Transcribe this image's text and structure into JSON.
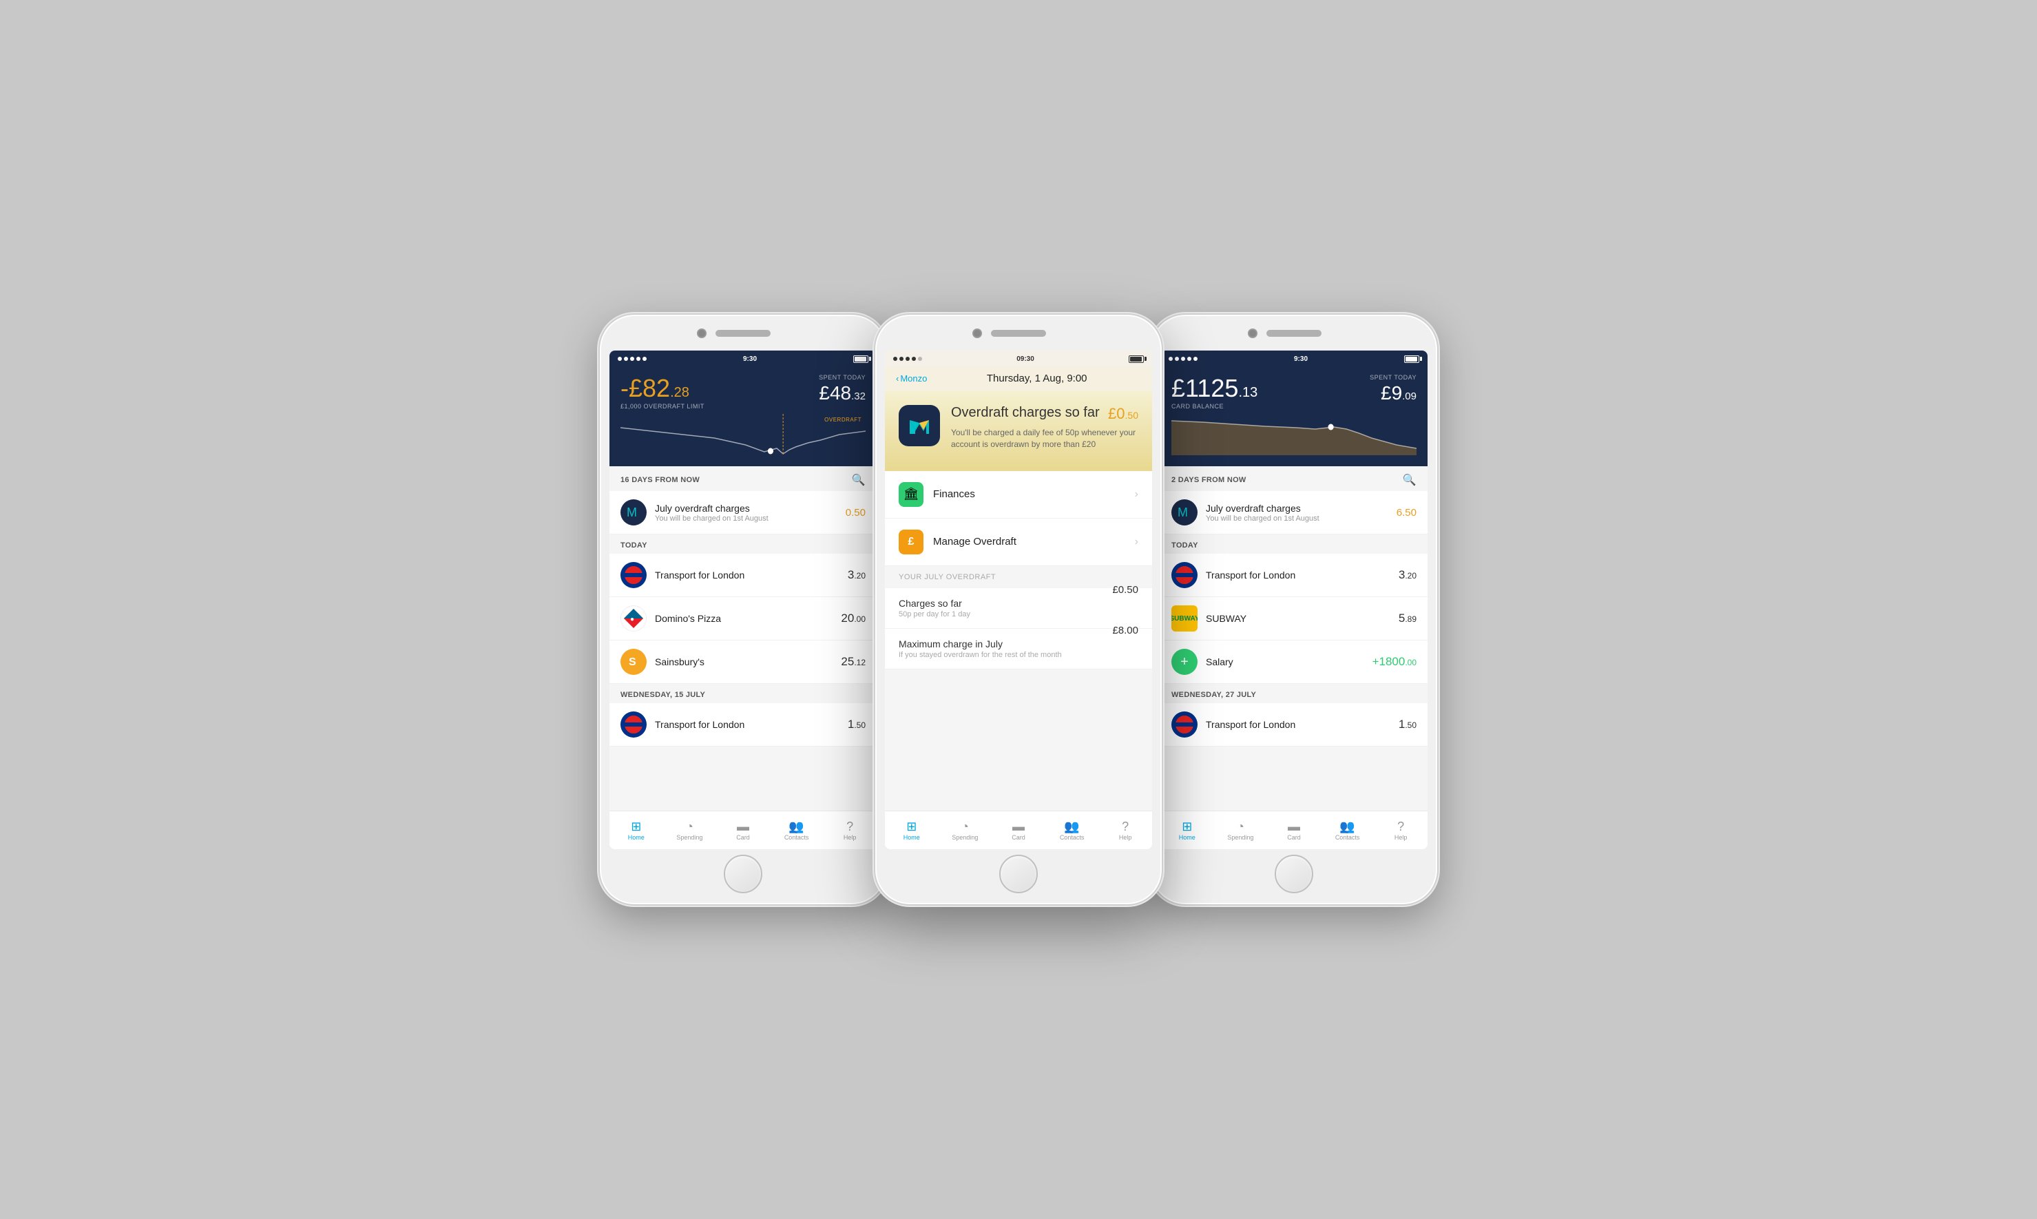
{
  "phone1": {
    "status": {
      "time": "9:30",
      "signal_dots": 5
    },
    "header": {
      "balance_sign": "-",
      "balance_currency": "£",
      "balance_whole": "82",
      "balance_decimal": ".28",
      "balance_label": "£1,000 OVERDRAFT LIMIT",
      "spent_currency": "£",
      "spent_whole": "48",
      "spent_decimal": ".32",
      "spent_label": "SPENT TODAY",
      "overdraft_label": "OVERDRAFT"
    },
    "section1": {
      "label": "16 DAYS FROM NOW"
    },
    "overdraft_item": {
      "name": "July overdraft charges",
      "sub": "You will be charged on 1st August",
      "amount_whole": "0",
      "amount_decimal": ".50"
    },
    "today_section": {
      "label": "TODAY"
    },
    "transactions": [
      {
        "name": "Transport for London",
        "sub": "",
        "amount_whole": "3",
        "amount_decimal": ".20",
        "type": "tfl"
      },
      {
        "name": "Domino's Pizza",
        "sub": "",
        "amount_whole": "20",
        "amount_decimal": ".00",
        "type": "dominos"
      },
      {
        "name": "Sainsbury's",
        "sub": "",
        "amount_whole": "25",
        "amount_decimal": ".12",
        "type": "sainsburys"
      }
    ],
    "section2": {
      "label": "WEDNESDAY, 15 JULY"
    },
    "transactions2": [
      {
        "name": "Transport for London",
        "sub": "",
        "amount_whole": "1",
        "amount_decimal": ".50",
        "type": "tfl"
      }
    ],
    "nav": {
      "items": [
        {
          "label": "Home",
          "active": true
        },
        {
          "label": "Spending",
          "active": false
        },
        {
          "label": "Card",
          "active": false
        },
        {
          "label": "Contacts",
          "active": false
        },
        {
          "label": "Help",
          "active": false
        }
      ]
    }
  },
  "phone2": {
    "status": {
      "time": "09:30"
    },
    "header": {
      "back_label": "Monzo",
      "date": "Thursday, 1 Aug, 9:00"
    },
    "overdraft": {
      "title": "Overdraft charges so far",
      "amount": "£0",
      "amount_decimal": ".50",
      "description": "You'll be charged a daily fee of 50p whenever your account is overdrawn by more than £20"
    },
    "menu_items": [
      {
        "label": "Finances",
        "icon_type": "bank"
      },
      {
        "label": "Manage Overdraft",
        "icon_type": "pound"
      }
    ],
    "section_label": "YOUR JULY OVERDRAFT",
    "detail_rows": [
      {
        "title": "Charges so far",
        "sub": "50p per day for 1 day",
        "amount": "£0.50"
      },
      {
        "title": "Maximum charge in July",
        "sub": "If you stayed overdrawn for the rest of the month",
        "amount": "£8.00"
      }
    ],
    "nav": {
      "items": [
        {
          "label": "Home",
          "active": true
        },
        {
          "label": "Spending",
          "active": false
        },
        {
          "label": "Card",
          "active": false
        },
        {
          "label": "Contacts",
          "active": false
        },
        {
          "label": "Help",
          "active": false
        }
      ]
    }
  },
  "phone3": {
    "status": {
      "time": "9:30"
    },
    "header": {
      "balance_currency": "£",
      "balance_whole": "1125",
      "balance_decimal": ".13",
      "balance_label": "CARD BALANCE",
      "spent_currency": "£",
      "spent_whole": "9",
      "spent_decimal": ".09",
      "spent_label": "SPENT TODAY"
    },
    "section1": {
      "label": "2 DAYS FROM NOW"
    },
    "overdraft_item": {
      "name": "July overdraft charges",
      "sub": "You will be charged on 1st August",
      "amount_whole": "6",
      "amount_decimal": ".50"
    },
    "today_section": {
      "label": "TODAY"
    },
    "transactions": [
      {
        "name": "Transport for London",
        "sub": "",
        "amount_whole": "3",
        "amount_decimal": ".20",
        "type": "tfl"
      },
      {
        "name": "SUBWAY",
        "sub": "",
        "amount_whole": "5",
        "amount_decimal": ".89",
        "type": "subway"
      },
      {
        "name": "Salary",
        "sub": "",
        "amount_whole": "+1800",
        "amount_decimal": ".00",
        "type": "salary",
        "positive": true
      }
    ],
    "section2": {
      "label": "WEDNESDAY, 27 JULY"
    },
    "transactions2": [
      {
        "name": "Transport for London",
        "sub": "",
        "amount_whole": "1",
        "amount_decimal": ".50",
        "type": "tfl"
      }
    ],
    "nav": {
      "items": [
        {
          "label": "Home",
          "active": true
        },
        {
          "label": "Spending",
          "active": false
        },
        {
          "label": "Card",
          "active": false
        },
        {
          "label": "Contacts",
          "active": false
        },
        {
          "label": "Help",
          "active": false
        }
      ]
    }
  }
}
